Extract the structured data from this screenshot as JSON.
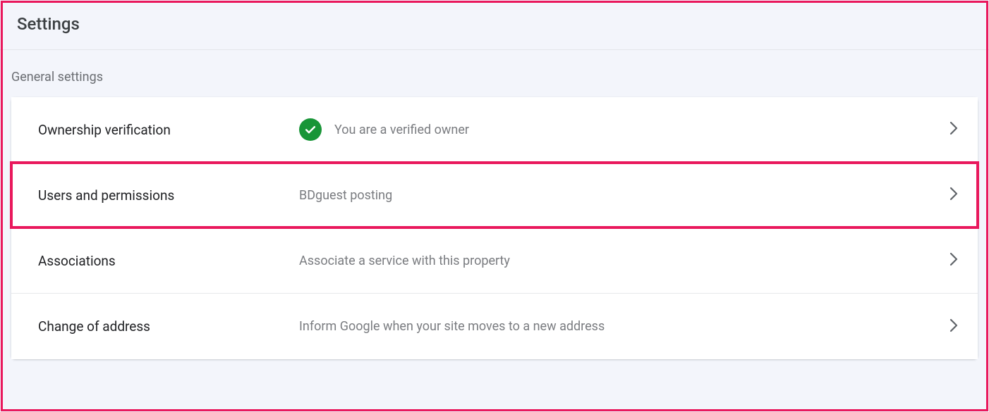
{
  "page_title": "Settings",
  "section_label": "General settings",
  "rows": [
    {
      "label": "Ownership verification",
      "value": "You are a verified owner",
      "has_check": true
    },
    {
      "label": "Users and permissions",
      "value": "BDguest posting",
      "has_check": false,
      "highlighted": true
    },
    {
      "label": "Associations",
      "value": "Associate a service with this property",
      "has_check": false
    },
    {
      "label": "Change of address",
      "value": "Inform Google when your site moves to a new address",
      "has_check": false
    }
  ]
}
